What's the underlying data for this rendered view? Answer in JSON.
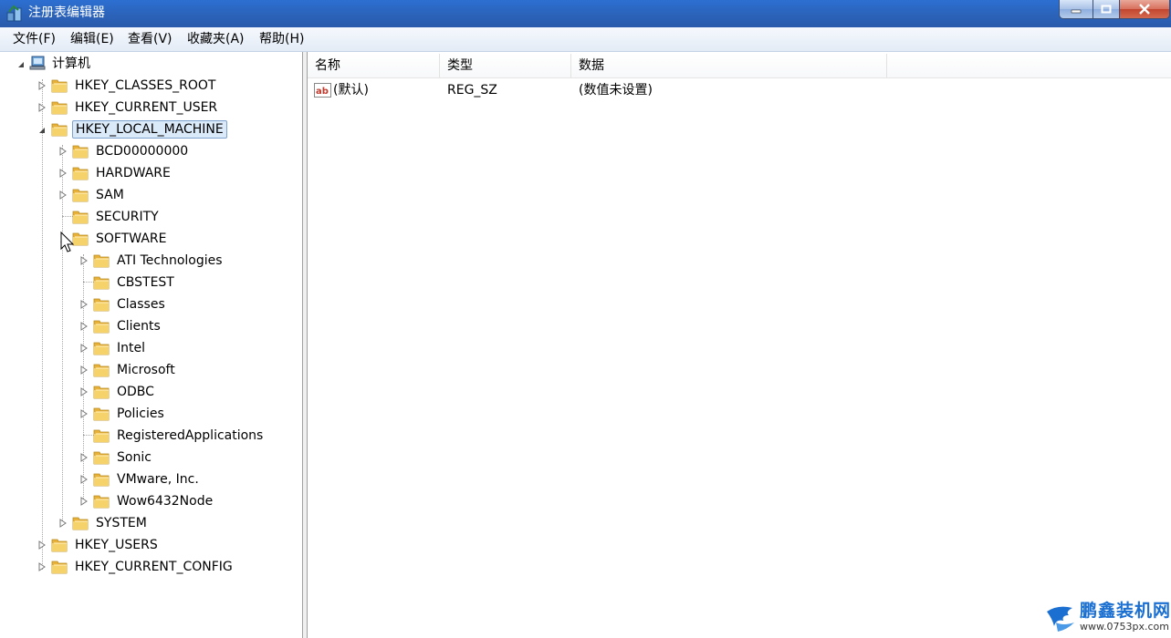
{
  "window": {
    "title": "注册表编辑器"
  },
  "menu": [
    "文件(F)",
    "编辑(E)",
    "查看(V)",
    "收藏夹(A)",
    "帮助(H)"
  ],
  "tree": {
    "root": "计算机",
    "nodes": [
      "HKEY_CLASSES_ROOT",
      "HKEY_CURRENT_USER",
      "HKEY_LOCAL_MACHINE",
      "BCD00000000",
      "HARDWARE",
      "SAM",
      "SECURITY",
      "SOFTWARE",
      "ATI Technologies",
      "CBSTEST",
      "Classes",
      "Clients",
      "Intel",
      "Microsoft",
      "ODBC",
      "Policies",
      "RegisteredApplications",
      "Sonic",
      "VMware, Inc.",
      "Wow6432Node",
      "SYSTEM",
      "HKEY_USERS",
      "HKEY_CURRENT_CONFIG"
    ]
  },
  "list": {
    "columns": [
      "名称",
      "类型",
      "数据"
    ],
    "rows": [
      {
        "name": "(默认)",
        "type": "REG_SZ",
        "data": "(数值未设置)"
      }
    ]
  },
  "watermark": {
    "text": "鹏鑫装机网",
    "url": "www.0753px.com"
  },
  "icons": {
    "app": "registry-editor-icon",
    "folder": "folder-icon",
    "computer": "computer-icon",
    "string-value": "string-value-icon"
  },
  "colors": {
    "titlebar": "#2b63b9",
    "selection": "#dbeaf9",
    "folder": "#f2c44b",
    "watermark": "#1a6fd0"
  }
}
